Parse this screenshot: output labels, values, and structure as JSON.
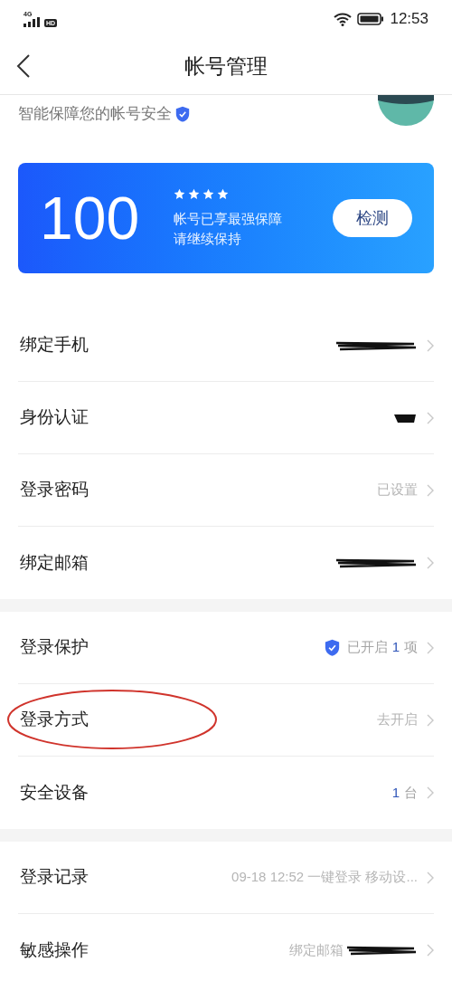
{
  "status_bar": {
    "network": "4G",
    "hd": "HD",
    "time": "12:53"
  },
  "header": {
    "title": "帐号管理"
  },
  "profile": {
    "subtitle": "智能保障您的帐号安全",
    "verified": true
  },
  "score_card": {
    "score": "100",
    "stars": 4,
    "line_1": "帐号已享最强保障",
    "line_2": "请继续保持",
    "button": "检测"
  },
  "sections": [
    {
      "rows": [
        {
          "label": "绑定手机",
          "kind": "redacted",
          "circled": false
        },
        {
          "label": "身份认证",
          "kind": "redacted_short",
          "circled": false
        },
        {
          "label": "登录密码",
          "kind": "text",
          "value": "已设置",
          "circled": false
        },
        {
          "label": "绑定邮箱",
          "kind": "redacted",
          "circled": false
        }
      ]
    },
    {
      "rows": [
        {
          "label": "登录保护",
          "kind": "protection",
          "value": "已开启",
          "count": "1",
          "unit": "项",
          "circled": false
        },
        {
          "label": "登录方式",
          "kind": "text",
          "value": "去开启",
          "circled": true
        },
        {
          "label": "安全设备",
          "kind": "count",
          "count": "1",
          "unit": "台",
          "circled": false
        }
      ]
    },
    {
      "rows": [
        {
          "label": "登录记录",
          "kind": "text",
          "value": "09-18 12:52 一键登录 移动设...",
          "circled": false
        },
        {
          "label": "敏感操作",
          "kind": "text_redacted",
          "value": "绑定邮箱",
          "circled": false
        }
      ]
    }
  ]
}
